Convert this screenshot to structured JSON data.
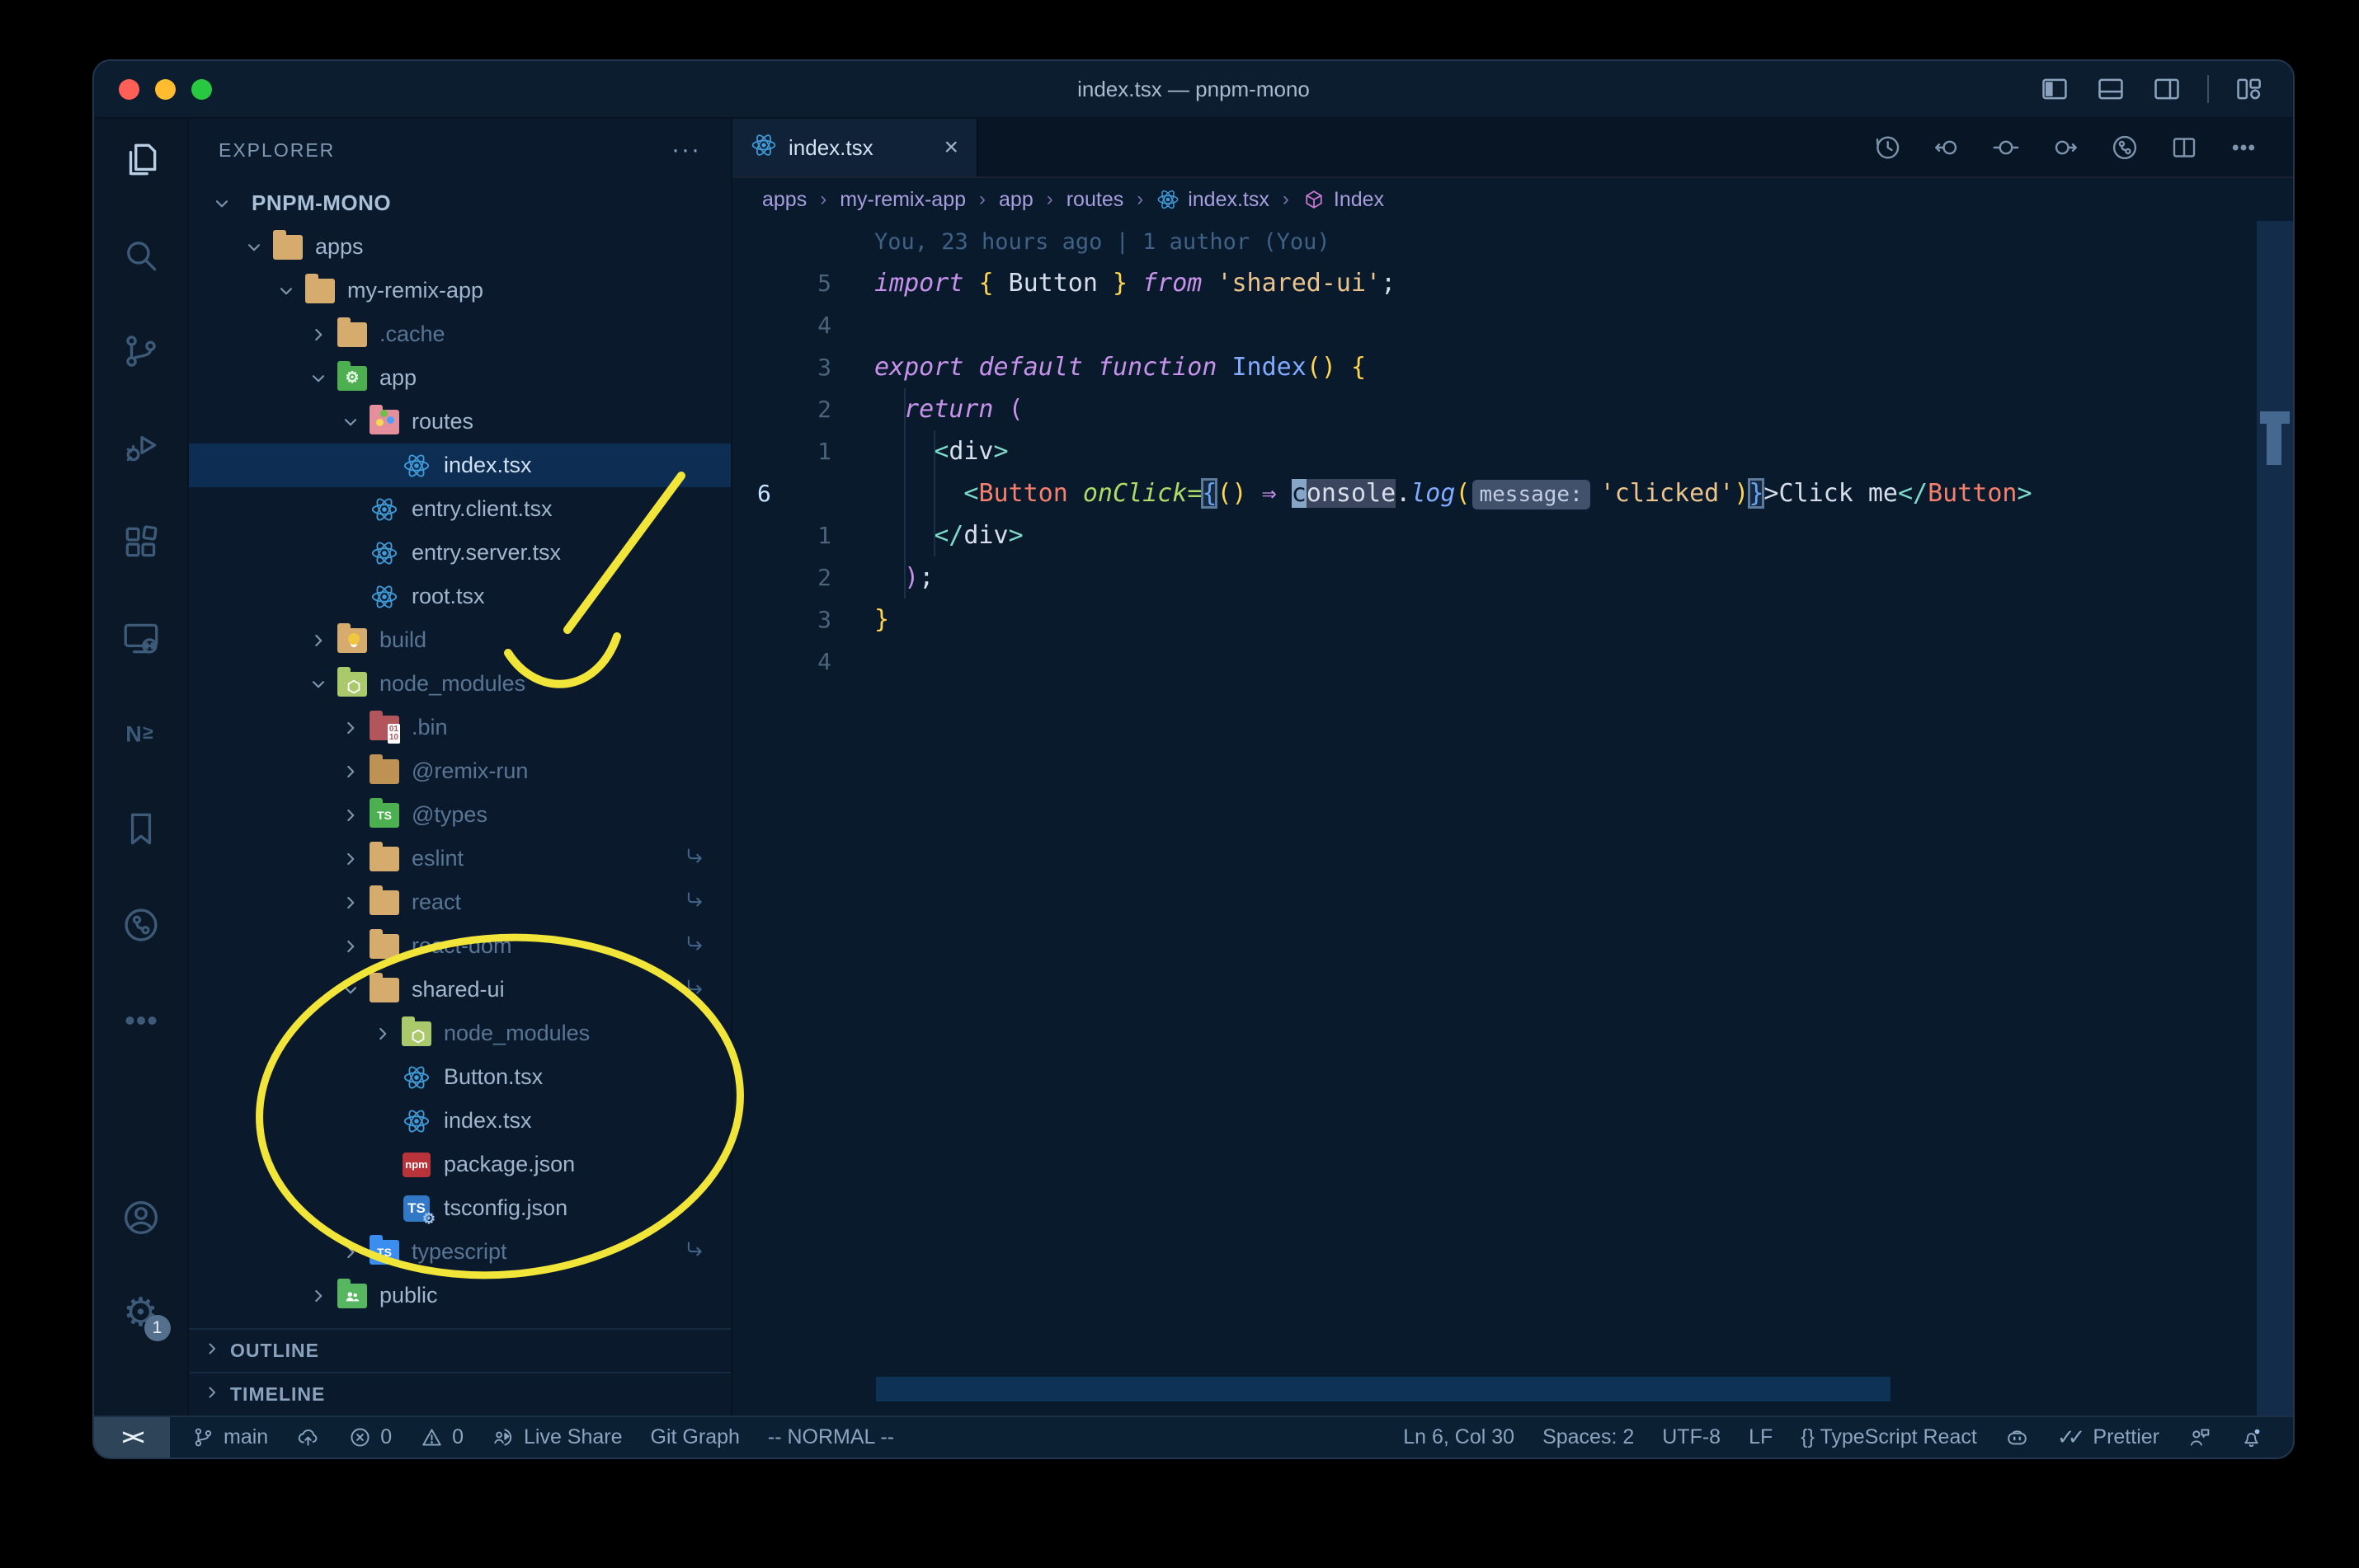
{
  "window": {
    "title": "index.tsx — pnpm-mono"
  },
  "titlebar": {
    "icons": [
      "layout-sidebar-left",
      "layout-panel",
      "layout-sidebar-right",
      "divider",
      "layout-customize"
    ]
  },
  "activity_bar": {
    "top": [
      {
        "name": "explorer",
        "icon": "files",
        "active": true
      },
      {
        "name": "search",
        "icon": "search",
        "active": false
      },
      {
        "name": "source-control",
        "icon": "source-control",
        "active": false
      },
      {
        "name": "run-debug",
        "icon": "debug",
        "active": false
      },
      {
        "name": "extensions",
        "icon": "extensions",
        "active": false
      },
      {
        "name": "remote-explorer",
        "icon": "remote",
        "active": false
      },
      {
        "name": "nx-console",
        "icon": "nx",
        "active": false
      },
      {
        "name": "bookmarks",
        "icon": "bookmark",
        "active": false
      },
      {
        "name": "git-graph",
        "icon": "git-circle",
        "active": false
      },
      {
        "name": "more-views",
        "icon": "ellipsis",
        "active": false
      }
    ],
    "bottom": [
      {
        "name": "accounts",
        "icon": "account",
        "active": false
      },
      {
        "name": "settings",
        "icon": "gear",
        "active": false,
        "badge": "1"
      }
    ]
  },
  "sidebar": {
    "header": "EXPLORER",
    "ellipsis": "···",
    "tree": [
      {
        "label": "PNPM-MONO",
        "level": 0,
        "root": true,
        "chevron": "open",
        "icon": "none"
      },
      {
        "label": "apps",
        "level": 1,
        "chevron": "open",
        "icon": "folder-tan"
      },
      {
        "label": "my-remix-app",
        "level": 2,
        "chevron": "open",
        "icon": "folder-tan"
      },
      {
        "label": ".cache",
        "level": 3,
        "chevron": "closed",
        "icon": "folder-tan",
        "dim": true
      },
      {
        "label": "app",
        "level": 3,
        "chevron": "open",
        "icon": "folder-app"
      },
      {
        "label": "routes",
        "level": 4,
        "chevron": "open",
        "icon": "folder-routes"
      },
      {
        "label": "index.tsx",
        "level": 5,
        "chevron": "none",
        "icon": "react",
        "selected": true
      },
      {
        "label": "entry.client.tsx",
        "level": 4,
        "chevron": "none",
        "icon": "react"
      },
      {
        "label": "entry.server.tsx",
        "level": 4,
        "chevron": "none",
        "icon": "react"
      },
      {
        "label": "root.tsx",
        "level": 4,
        "chevron": "none",
        "icon": "react"
      },
      {
        "label": "build",
        "level": 3,
        "chevron": "closed",
        "icon": "folder-build",
        "dim": true
      },
      {
        "label": "node_modules",
        "level": 3,
        "chevron": "open",
        "icon": "folder-nm",
        "dim": true
      },
      {
        "label": ".bin",
        "level": 4,
        "chevron": "closed",
        "icon": "folder-bin",
        "dim": true
      },
      {
        "label": "@remix-run",
        "level": 4,
        "chevron": "closed",
        "icon": "folder-dark",
        "dim": true
      },
      {
        "label": "@types",
        "level": 4,
        "chevron": "closed",
        "icon": "folder-types",
        "dim": true
      },
      {
        "label": "eslint",
        "level": 4,
        "chevron": "closed",
        "icon": "folder-tan",
        "dim": true,
        "symlink": true
      },
      {
        "label": "react",
        "level": 4,
        "chevron": "closed",
        "icon": "folder-tan",
        "dim": true,
        "symlink": true
      },
      {
        "label": "react-dom",
        "level": 4,
        "chevron": "closed",
        "icon": "folder-tan",
        "dim": true,
        "symlink": true
      },
      {
        "label": "shared-ui",
        "level": 4,
        "chevron": "open",
        "icon": "folder-tan",
        "symlink": true
      },
      {
        "label": "node_modules",
        "level": 5,
        "chevron": "closed",
        "icon": "folder-nm",
        "dim": true
      },
      {
        "label": "Button.tsx",
        "level": 5,
        "chevron": "none",
        "icon": "react"
      },
      {
        "label": "index.tsx",
        "level": 5,
        "chevron": "none",
        "icon": "react"
      },
      {
        "label": "package.json",
        "level": 5,
        "chevron": "none",
        "icon": "npm"
      },
      {
        "label": "tsconfig.json",
        "level": 5,
        "chevron": "none",
        "icon": "tsconfig"
      },
      {
        "label": "typescript",
        "level": 4,
        "chevron": "closed",
        "icon": "folder-ts",
        "dim": true,
        "symlink": true
      },
      {
        "label": "public",
        "level": 3,
        "chevron": "closed",
        "icon": "folder-public"
      }
    ],
    "sections": [
      {
        "label": "OUTLINE"
      },
      {
        "label": "TIMELINE"
      }
    ]
  },
  "editor": {
    "tab": {
      "label": "index.tsx",
      "icon": "react",
      "close": "×"
    },
    "actions": [
      "history",
      "prev-change",
      "open-change",
      "next-change",
      "git-circle",
      "split-editor",
      "ellipsis-h"
    ],
    "breadcrumbs": [
      {
        "label": "apps"
      },
      {
        "label": "my-remix-app"
      },
      {
        "label": "app"
      },
      {
        "label": "routes"
      },
      {
        "label": "index.tsx",
        "icon": "react"
      },
      {
        "label": "Index",
        "icon": "symbol-module"
      }
    ],
    "blame": "You, 23 hours ago | 1 author (You)",
    "code_lines": [
      {
        "n": "5",
        "tokens": [
          [
            "kw",
            "import"
          ],
          [
            "text",
            " "
          ],
          [
            "gold",
            "{"
          ],
          [
            "text",
            " Button "
          ],
          [
            "gold",
            "}"
          ],
          [
            "text",
            " "
          ],
          [
            "kw",
            "from"
          ],
          [
            "text",
            " "
          ],
          [
            "str",
            "'shared-ui'"
          ],
          [
            "text",
            ";"
          ]
        ]
      },
      {
        "n": "4",
        "tokens": []
      },
      {
        "n": "3",
        "tokens": [
          [
            "kw",
            "export"
          ],
          [
            "text",
            " "
          ],
          [
            "kw",
            "default"
          ],
          [
            "text",
            " "
          ],
          [
            "kw",
            "function"
          ],
          [
            "text",
            " "
          ],
          [
            "blue",
            "Index"
          ],
          [
            "gold",
            "()"
          ],
          [
            "text",
            " "
          ],
          [
            "gold",
            "{"
          ]
        ]
      },
      {
        "n": "2",
        "tokens": [
          [
            "text",
            "  "
          ],
          [
            "kw",
            "return"
          ],
          [
            "text",
            " "
          ],
          [
            "mag",
            "("
          ]
        ]
      },
      {
        "n": "1",
        "tokens": [
          [
            "text",
            "    "
          ],
          [
            "teal",
            "<"
          ],
          [
            "text",
            "div"
          ],
          [
            "teal",
            ">"
          ]
        ]
      },
      {
        "n": "6",
        "current": true,
        "tokens": [
          [
            "text",
            "      "
          ],
          [
            "teal",
            "<"
          ],
          [
            "comp",
            "Button"
          ],
          [
            "text",
            " "
          ],
          [
            "attr",
            "onClick"
          ],
          [
            "attr",
            "="
          ],
          [
            "bm",
            "{"
          ],
          [
            "gold",
            "()"
          ],
          [
            "text",
            " "
          ],
          [
            "arrow",
            "⇒"
          ],
          [
            "text",
            " "
          ],
          [
            "cursor",
            "c"
          ],
          [
            "hl",
            "onsole"
          ],
          [
            "text",
            "."
          ],
          [
            "fn",
            "log"
          ],
          [
            "gold",
            "("
          ],
          [
            "inlay",
            "message:"
          ],
          [
            "str",
            "'clicked'"
          ],
          [
            "gold",
            ")"
          ],
          [
            "bm",
            "}"
          ],
          [
            "text",
            ">Click me"
          ],
          [
            "teal",
            "</"
          ],
          [
            "comp",
            "Button"
          ],
          [
            "teal",
            ">"
          ]
        ]
      },
      {
        "n": "1",
        "tokens": [
          [
            "text",
            "    "
          ],
          [
            "teal",
            "</"
          ],
          [
            "text",
            "div"
          ],
          [
            "teal",
            ">"
          ]
        ]
      },
      {
        "n": "2",
        "tokens": [
          [
            "text",
            "  "
          ],
          [
            "mag",
            ")"
          ],
          [
            "text",
            ";"
          ]
        ]
      },
      {
        "n": "3",
        "tokens": [
          [
            "gold",
            "}"
          ]
        ]
      },
      {
        "n": "4",
        "tokens": []
      }
    ]
  },
  "status_bar": {
    "left": [
      {
        "icon": "git-branch",
        "label": "main",
        "name": "branch"
      },
      {
        "icon": "cloud-upload",
        "label": "",
        "name": "publish"
      },
      {
        "icon": "error",
        "label": "0",
        "name": "errors"
      },
      {
        "icon": "warning",
        "label": "0",
        "name": "warnings"
      },
      {
        "icon": "live-share",
        "label": "Live Share",
        "name": "live-share"
      },
      {
        "icon": "",
        "label": "Git Graph",
        "name": "git-graph"
      },
      {
        "icon": "",
        "label": "-- NORMAL --",
        "name": "vim-mode"
      }
    ],
    "remote": "><",
    "right": [
      {
        "icon": "",
        "label": "Ln 6, Col 30",
        "name": "cursor-position"
      },
      {
        "icon": "",
        "label": "Spaces: 2",
        "name": "indentation"
      },
      {
        "icon": "",
        "label": "UTF-8",
        "name": "encoding"
      },
      {
        "icon": "",
        "label": "LF",
        "name": "eol"
      },
      {
        "icon": "",
        "label": "{} TypeScript React",
        "name": "language-mode"
      },
      {
        "icon": "copilot",
        "label": "",
        "name": "copilot"
      },
      {
        "icon": "checks",
        "label": "Prettier",
        "name": "prettier"
      },
      {
        "icon": "feedback",
        "label": "",
        "name": "feedback"
      },
      {
        "icon": "bell",
        "label": "",
        "name": "notifications"
      }
    ]
  },
  "annotations": {
    "color": "#f2e53a"
  },
  "colors": {
    "selection_row": "#0e2d52",
    "editor_bg": "#0a1a2d",
    "accent_yellow": "#ffd54f",
    "keyword_pink": "#c792ea",
    "string_peach": "#ecc48d",
    "component_salmon": "#f6806c"
  }
}
